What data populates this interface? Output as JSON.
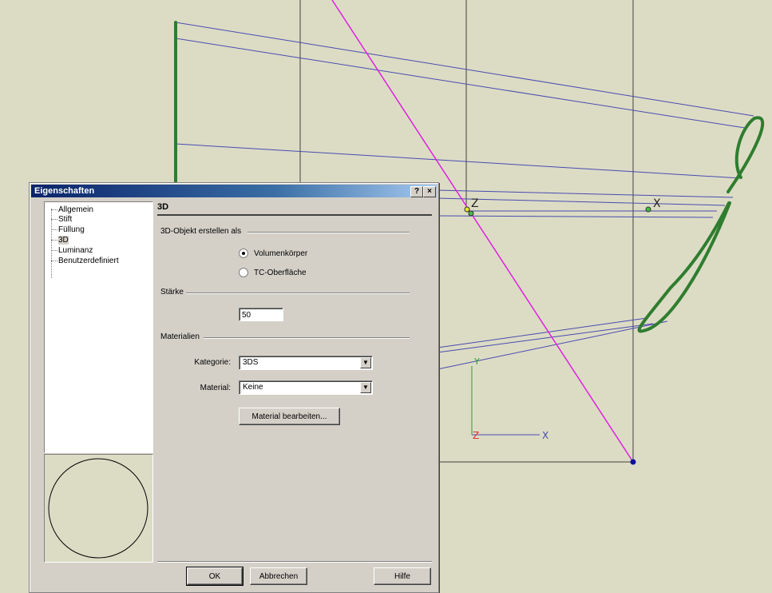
{
  "viewport": {
    "axis_labels": {
      "z_top": "Z",
      "x_top": "X",
      "y_bottom": "Y",
      "z_bottom": "Z",
      "x_bottom": "X"
    },
    "colors": {
      "background": "#dcdcc5",
      "wire": "#4a4ab0",
      "profile": "#2f7d2f",
      "diagonal": "#e020e0",
      "grid": "#404040"
    }
  },
  "dialog": {
    "title": "Eigenschaften",
    "help_title_button": "?",
    "close_title_button": "×",
    "tree": [
      {
        "label": "Allgemein",
        "selected": false
      },
      {
        "label": "Stift",
        "selected": false
      },
      {
        "label": "Füllung",
        "selected": false
      },
      {
        "label": "3D",
        "selected": true
      },
      {
        "label": "Luminanz",
        "selected": false
      },
      {
        "label": "Benutzerdefiniert",
        "selected": false
      }
    ],
    "page_title": "3D",
    "create_group": {
      "label": "3D-Objekt erstellen als",
      "options": [
        {
          "label": "Volumenkörper",
          "checked": true
        },
        {
          "label": "TC-Oberfläche",
          "checked": false
        }
      ]
    },
    "thickness": {
      "label": "Stärke",
      "value": "50"
    },
    "materials": {
      "label": "Materialien",
      "category_label": "Kategorie:",
      "category_value": "3DS",
      "material_label": "Material:",
      "material_value": "Keine",
      "edit_button": "Material bearbeiten..."
    },
    "buttons": {
      "ok": "OK",
      "cancel": "Abbrechen",
      "help": "Hilfe"
    }
  }
}
